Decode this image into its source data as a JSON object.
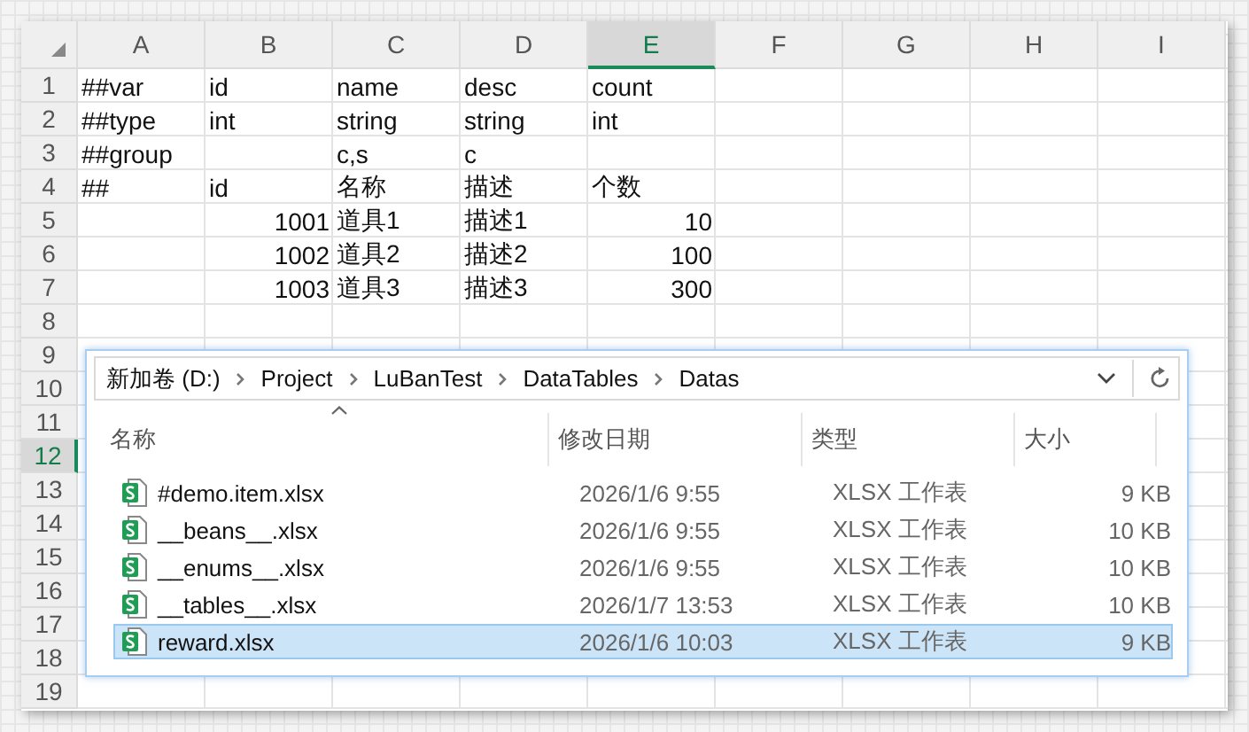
{
  "sheet": {
    "columns": [
      {
        "label": "A",
        "selected": false
      },
      {
        "label": "B",
        "selected": false
      },
      {
        "label": "C",
        "selected": false
      },
      {
        "label": "D",
        "selected": false
      },
      {
        "label": "E",
        "selected": true
      },
      {
        "label": "F",
        "selected": false
      },
      {
        "label": "G",
        "selected": false
      },
      {
        "label": "H",
        "selected": false
      },
      {
        "label": "I",
        "selected": false
      }
    ],
    "rows": [
      {
        "number": "1",
        "selected": false,
        "cells": [
          {
            "text": "##var",
            "kind": "text"
          },
          {
            "text": "id",
            "kind": "text"
          },
          {
            "text": "name",
            "kind": "text"
          },
          {
            "text": "desc",
            "kind": "text"
          },
          {
            "text": "count",
            "kind": "text"
          }
        ]
      },
      {
        "number": "2",
        "selected": false,
        "cells": [
          {
            "text": "##type",
            "kind": "text"
          },
          {
            "text": "int",
            "kind": "text"
          },
          {
            "text": "string",
            "kind": "text"
          },
          {
            "text": "string",
            "kind": "text"
          },
          {
            "text": "int",
            "kind": "text"
          }
        ]
      },
      {
        "number": "3",
        "selected": false,
        "cells": [
          {
            "text": "##group",
            "kind": "text"
          },
          null,
          {
            "text": "c,s",
            "kind": "text"
          },
          {
            "text": "c",
            "kind": "text"
          },
          null
        ]
      },
      {
        "number": "4",
        "selected": false,
        "cells": [
          {
            "text": "##",
            "kind": "text"
          },
          {
            "text": "id",
            "kind": "text"
          },
          {
            "text": "名称",
            "kind": "text"
          },
          {
            "text": "描述",
            "kind": "text"
          },
          {
            "text": "个数",
            "kind": "text"
          }
        ]
      },
      {
        "number": "5",
        "selected": false,
        "cells": [
          null,
          {
            "text": "1001",
            "kind": "number"
          },
          {
            "text": "道具1",
            "kind": "text"
          },
          {
            "text": "描述1",
            "kind": "text"
          },
          {
            "text": "10",
            "kind": "number"
          }
        ]
      },
      {
        "number": "6",
        "selected": false,
        "cells": [
          null,
          {
            "text": "1002",
            "kind": "number"
          },
          {
            "text": "道具2",
            "kind": "text"
          },
          {
            "text": "描述2",
            "kind": "text"
          },
          {
            "text": "100",
            "kind": "number"
          }
        ]
      },
      {
        "number": "7",
        "selected": false,
        "cells": [
          null,
          {
            "text": "1003",
            "kind": "number"
          },
          {
            "text": "道具3",
            "kind": "text"
          },
          {
            "text": "描述3",
            "kind": "text"
          },
          {
            "text": "300",
            "kind": "number"
          }
        ]
      },
      {
        "number": "8",
        "selected": false
      },
      {
        "number": "9",
        "selected": false
      },
      {
        "number": "10",
        "selected": false
      },
      {
        "number": "11",
        "selected": false
      },
      {
        "number": "12",
        "selected": true
      },
      {
        "number": "13",
        "selected": false
      },
      {
        "number": "14",
        "selected": false
      },
      {
        "number": "15",
        "selected": false
      },
      {
        "number": "16",
        "selected": false
      },
      {
        "number": "17",
        "selected": false
      },
      {
        "number": "18",
        "selected": false
      },
      {
        "number": "19",
        "selected": false
      }
    ]
  },
  "explorer": {
    "breadcrumb": [
      "新加卷 (D:)",
      "Project",
      "LuBanTest",
      "DataTables",
      "Datas"
    ],
    "columns": [
      "名称",
      "修改日期",
      "类型",
      "大小"
    ],
    "files": [
      {
        "name": "#demo.item.xlsx",
        "date": "2026/1/6 9:55",
        "type": "XLSX 工作表",
        "size": "9 KB",
        "selected": false
      },
      {
        "name": "__beans__.xlsx",
        "date": "2026/1/6 9:55",
        "type": "XLSX 工作表",
        "size": "10 KB",
        "selected": false
      },
      {
        "name": "__enums__.xlsx",
        "date": "2026/1/6 9:55",
        "type": "XLSX 工作表",
        "size": "10 KB",
        "selected": false
      },
      {
        "name": "__tables__.xlsx",
        "date": "2026/1/7 13:53",
        "type": "XLSX 工作表",
        "size": "10 KB",
        "selected": false
      },
      {
        "name": "reward.xlsx",
        "date": "2026/1/6 10:03",
        "type": "XLSX 工作表",
        "size": "9 KB",
        "selected": true
      }
    ]
  }
}
